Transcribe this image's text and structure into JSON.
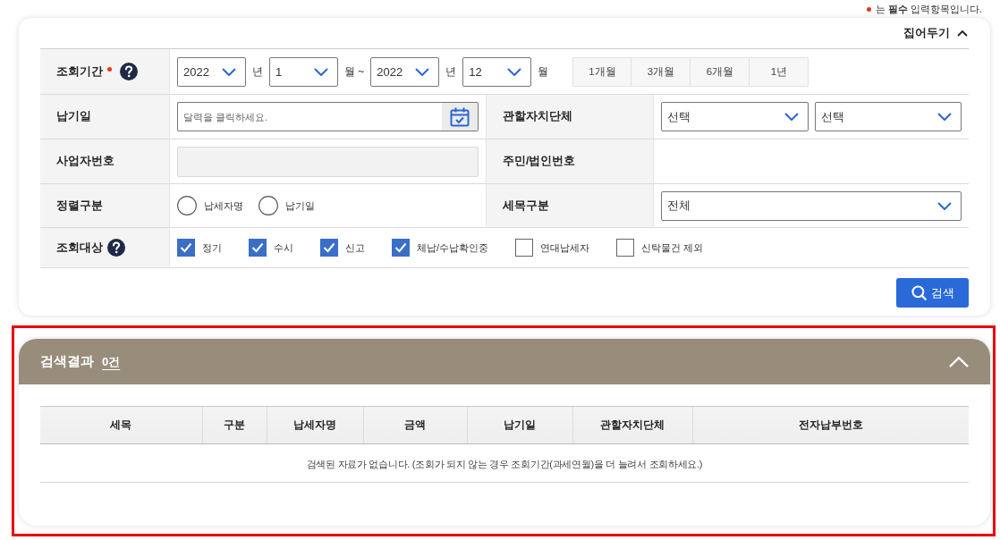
{
  "required_note": {
    "text": "는 **필수** 입력항목입니다."
  },
  "search_form": {
    "collapse_toggle": {
      "label": "집어두기",
      "expanded": true
    },
    "rows": [
      {
        "fields": [
          {
            "label": "조회기간",
            "required": true,
            "help": true,
            "controls": [
              {
                "kind": "select",
                "value": "2022"
              },
              {
                "kind": "unit",
                "text": "년"
              },
              {
                "kind": "select",
                "value": "1"
              },
              {
                "kind": "unit",
                "text": "월 ~"
              },
              {
                "kind": "select",
                "value": "2022"
              },
              {
                "kind": "unit",
                "text": "년"
              },
              {
                "kind": "select",
                "value": "12"
              },
              {
                "kind": "unit",
                "text": "월"
              },
              {
                "kind": "period_buttons",
                "items": [
                  "1개월",
                  "3개월",
                  "6개월",
                  "1년"
                ]
              }
            ]
          }
        ]
      },
      {
        "fields": [
          {
            "label": "납기일",
            "required": false,
            "help": false,
            "controls": [
              {
                "kind": "date",
                "placeholder": "달력을 클릭하세요."
              }
            ]
          },
          {
            "label": "관할자치단체",
            "required": false,
            "help": false,
            "controls": [
              {
                "kind": "select",
                "value": "선택"
              },
              {
                "kind": "select",
                "value": "선택"
              }
            ]
          }
        ]
      },
      {
        "fields": [
          {
            "label": "사업자번호",
            "required": false,
            "help": false,
            "controls": [
              {
                "kind": "input",
                "disabled": true
              }
            ]
          },
          {
            "label": "주민/법인번호",
            "required": false,
            "help": false
          }
        ]
      },
      {
        "fields": [
          {
            "label": "정렬구분",
            "required": false,
            "help": false,
            "controls": [
              {
                "kind": "radio",
                "label": "납세자명",
                "selected": false
              },
              {
                "kind": "radio",
                "label": "납기일",
                "selected": false
              }
            ]
          },
          {
            "label": "세목구분",
            "required": false,
            "help": false,
            "controls": [
              {
                "kind": "select",
                "value": "전체"
              }
            ]
          }
        ]
      },
      {
        "fields": [
          {
            "label": "조회대상",
            "required": false,
            "help": true,
            "controls": [
              {
                "kind": "checkbox",
                "label": "정기",
                "checked": true
              },
              {
                "kind": "checkbox",
                "label": "수시",
                "checked": true
              },
              {
                "kind": "checkbox",
                "label": "신고",
                "checked": true
              },
              {
                "kind": "checkbox",
                "label": "체납/수납확인중",
                "checked": true
              },
              {
                "kind": "checkbox",
                "label": "연대납세자",
                "checked": false
              },
              {
                "kind": "checkbox",
                "label": "신탁물건 제외",
                "checked": false
              }
            ]
          }
        ]
      }
    ],
    "search_button": {
      "label": "검색"
    }
  },
  "results": {
    "highlighted": true,
    "title": "검색결과",
    "count": "0건",
    "expanded": true,
    "table": {
      "columns": [
        "세목",
        "구분",
        "납세자명",
        "금액",
        "납기일",
        "관할자치단체",
        "전자납부번호"
      ],
      "empty_message": "검색된 자료가 없습니다. (조회가 되지 않는 경우 조회기간(과세연월)을 더 늘려서 조회하세요.)"
    }
  }
}
